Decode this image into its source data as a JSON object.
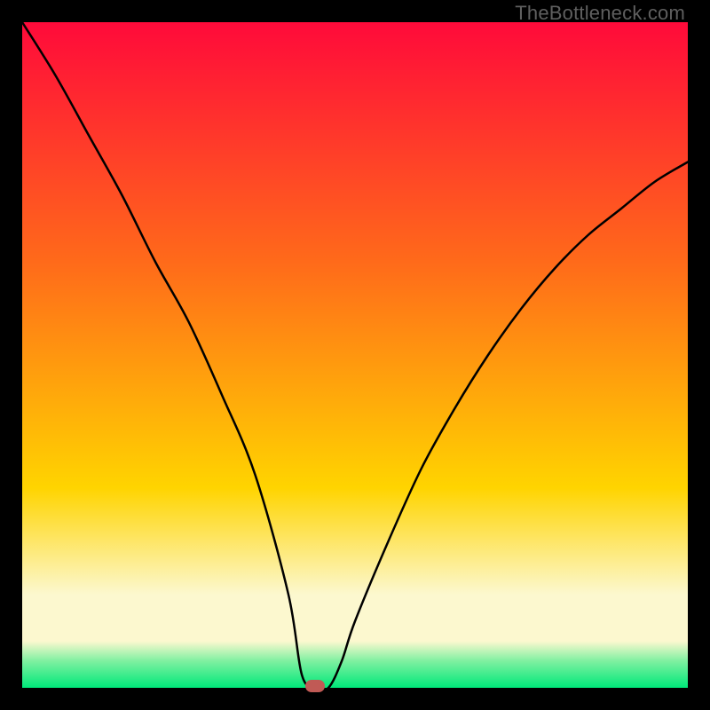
{
  "watermark": "TheBottleneck.com",
  "colors": {
    "top": "#ff0a3a",
    "mid1": "#ff6a1a",
    "mid2": "#ffd400",
    "band": "#fcf8cf",
    "green_light": "#7ef0a0",
    "green": "#00e87a",
    "black": "#000000",
    "curve": "#000000",
    "marker": "#c05a55"
  },
  "chart_data": {
    "type": "line",
    "title": "",
    "xlabel": "",
    "ylabel": "",
    "xlim": [
      0,
      100
    ],
    "ylim": [
      0,
      100
    ],
    "note": "V-shaped bottleneck curve; y values are estimated from gridless chart (percent of vertical range, 0 = bottom green, 100 = top red). Minimum occurs near x≈42–46.",
    "series": [
      {
        "name": "bottleneck-curve",
        "x": [
          0,
          5,
          10,
          15,
          20,
          25,
          30,
          35,
          40,
          42,
          44,
          46,
          48,
          50,
          55,
          60,
          65,
          70,
          75,
          80,
          85,
          90,
          95,
          100
        ],
        "values": [
          100,
          92,
          83,
          74,
          64,
          55,
          44,
          32,
          14,
          2,
          0,
          0,
          4,
          10,
          22,
          33,
          42,
          50,
          57,
          63,
          68,
          72,
          76,
          79
        ]
      }
    ],
    "marker": {
      "x": 44,
      "y": 0
    },
    "gradient_stops": [
      {
        "pct": 0,
        "color_key": "top"
      },
      {
        "pct": 36,
        "color_key": "mid1"
      },
      {
        "pct": 70,
        "color_key": "mid2"
      },
      {
        "pct": 86,
        "color_key": "band"
      },
      {
        "pct": 93,
        "color_key": "band"
      },
      {
        "pct": 96,
        "color_key": "green_light"
      },
      {
        "pct": 100,
        "color_key": "green"
      }
    ]
  }
}
